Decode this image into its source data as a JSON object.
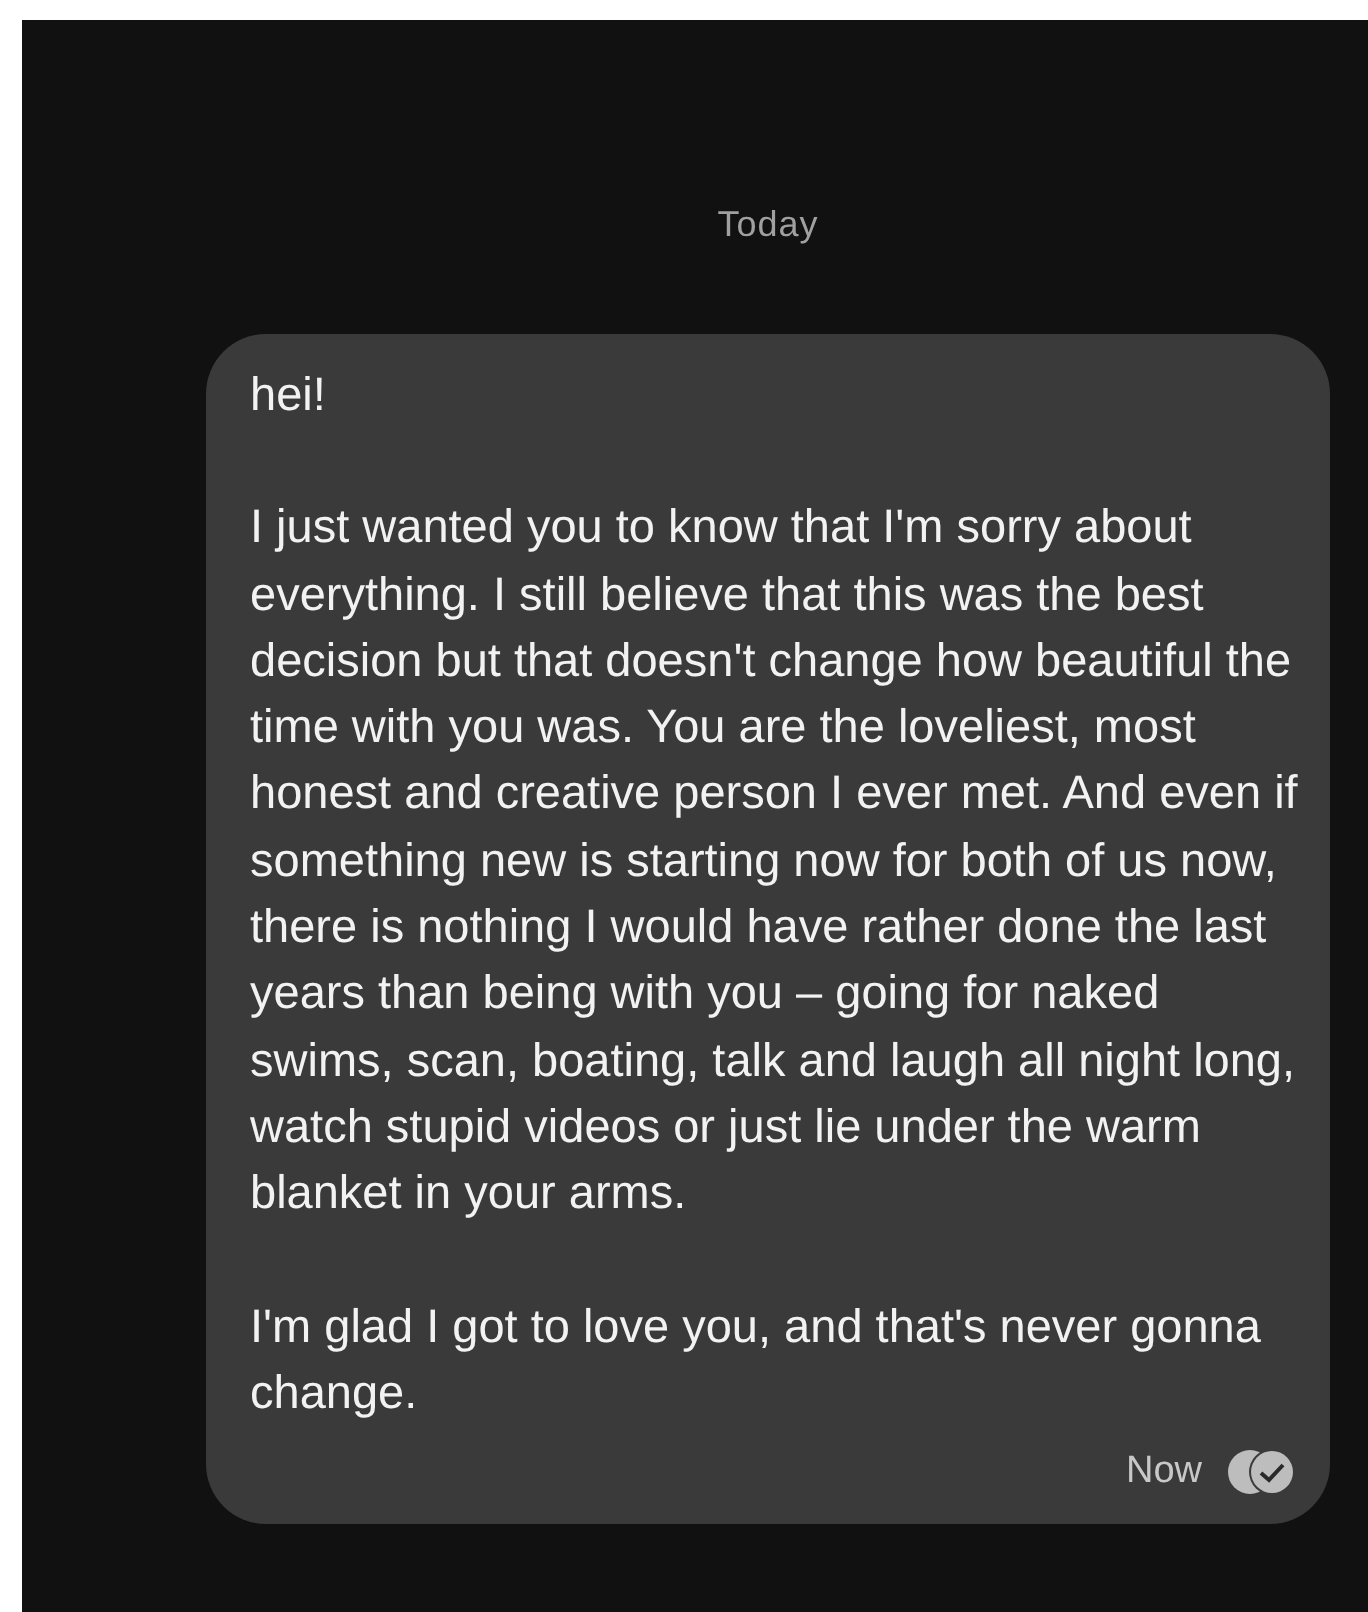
{
  "date_divider": "Today",
  "message": {
    "paragraphs": [
      "hei!",
      "I just wanted you to know that I'm sorry about everything. I still believe that this was the best decision but that doesn't change how beautiful the time with you was. You are the loveliest, most honest and creative person I ever met. And even if something new is starting now for both of us now, there is nothing I would have rather done the last years than being with you – going for naked swims, scan, boating, talk and laugh all night long, watch stupid videos or just lie under the warm blanket in your arms.",
      "I'm glad I got to love you, and that's never gonna change."
    ],
    "time": "Now",
    "read": true
  }
}
